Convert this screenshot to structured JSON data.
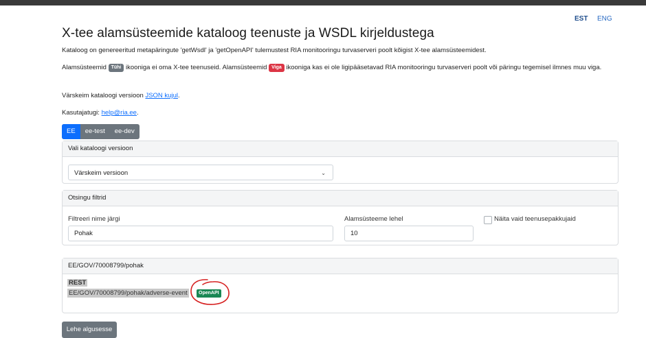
{
  "languages": {
    "est": "EST",
    "eng": "ENG"
  },
  "title": "X-tee alamsüsteemide kataloog teenuste ja WSDL kirjeldustega",
  "intro": "Kataloog on genereeritud metapäringute 'getWsdl' ja 'getOpenAPI' tulemustest RIA monitooringu turvaserveri poolt kõigist X-tee alamsüsteemidest.",
  "legend": {
    "part1": "Alamsüsteemid ",
    "badge_empty": "Tühi",
    "part2": " ikooniga ei oma X-tee teenuseid. Alamsüsteemid ",
    "badge_error": "Viga",
    "part3": " ikooniga kas ei ole ligipääsetavad RIA monitooringu turvaserveri poolt või päringu tegemisel ilmnes muu viga."
  },
  "latest": {
    "text": "Värskeim kataloogi versioon ",
    "link": "JSON kujul",
    "suffix": "."
  },
  "support": {
    "text": "Kasutajatugi: ",
    "link": "help@ria.ee",
    "suffix": "."
  },
  "tabs": [
    {
      "label": "EE",
      "active": true
    },
    {
      "label": "ee-test",
      "active": false
    },
    {
      "label": "ee-dev",
      "active": false
    }
  ],
  "version_card": {
    "header": "Vali kataloogi versioon",
    "selected": "Värskeim versioon"
  },
  "filter_card": {
    "header": "Otsingu filtrid",
    "name_label": "Filtreeri nime järgi",
    "name_value": "Pohak",
    "per_page_label": "Alamsüsteeme lehel",
    "per_page_value": "10",
    "providers_label": "Näita vaid teenusepakkujaid"
  },
  "result_card": {
    "header": "EE/GOV/70008799/pohak",
    "type": "REST",
    "service": "EE/GOV/70008799/pohak/adverse-event",
    "badge": "OpenAPI"
  },
  "back_button": "Lehe algusesse",
  "colors": {
    "primary": "#0d6efd",
    "secondary": "#6c757d",
    "success": "#198754",
    "danger": "#dc3545",
    "annotation": "#d61f1f"
  }
}
